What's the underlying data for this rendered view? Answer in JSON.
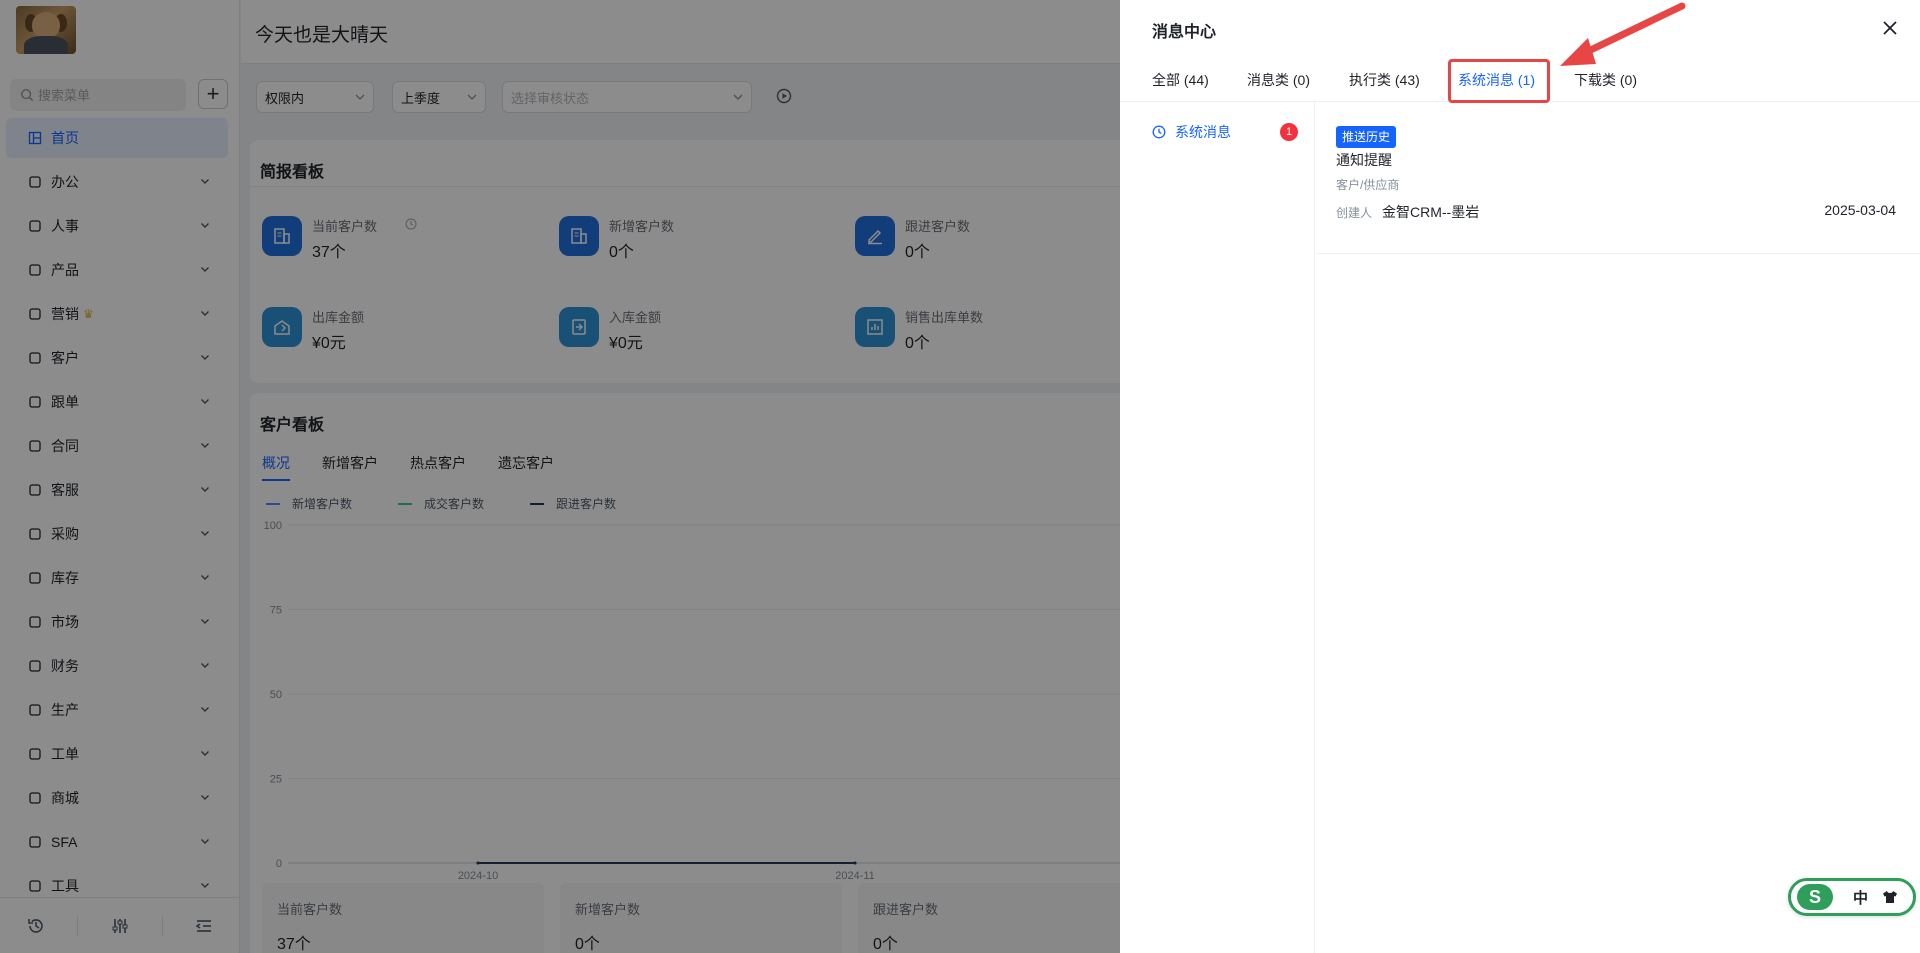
{
  "colors": {
    "primary": "#1664ff",
    "badge": "#f5313e",
    "highlight": "#e84545",
    "series_new": "#4f8ff7",
    "series_deal": "#36c3a0",
    "series_follow": "#2b3a55"
  },
  "sidebar": {
    "search_placeholder": "搜索菜单",
    "add_label": "+",
    "items": [
      {
        "label": "首页",
        "icon": "grid-icon",
        "active": true
      },
      {
        "label": "办公",
        "icon": "monitor-icon"
      },
      {
        "label": "人事",
        "icon": "people-icon"
      },
      {
        "label": "产品",
        "icon": "cube-icon"
      },
      {
        "label": "营销",
        "icon": "copy-icon",
        "crown": "♛"
      },
      {
        "label": "客户",
        "icon": "chart-icon"
      },
      {
        "label": "跟单",
        "icon": "shield-icon"
      },
      {
        "label": "合同",
        "icon": "document-icon"
      },
      {
        "label": "客服",
        "icon": "headset-icon"
      },
      {
        "label": "采购",
        "icon": "briefcase-icon"
      },
      {
        "label": "库存",
        "icon": "warehouse-icon"
      },
      {
        "label": "市场",
        "icon": "bookmark-icon"
      },
      {
        "label": "财务",
        "icon": "home-icon"
      },
      {
        "label": "生产",
        "icon": "factory-icon"
      },
      {
        "label": "工单",
        "icon": "form-icon"
      },
      {
        "label": "商城",
        "icon": "store-icon"
      },
      {
        "label": "SFA",
        "icon": "cycle-icon"
      },
      {
        "label": "工具",
        "icon": "toolbox-icon"
      }
    ],
    "footer_icons": [
      "history-icon",
      "sliders-icon",
      "collapse-icon"
    ]
  },
  "header": {
    "greeting": "今天也是大晴天"
  },
  "filters": {
    "scope": "权限内",
    "period": "上季度",
    "status_placeholder": "选择审核状态"
  },
  "brief_board": {
    "title": "简报看板",
    "kpis": [
      {
        "label": "当前客户数",
        "value": "37个"
      },
      {
        "label": "新增客户数",
        "value": "0个"
      },
      {
        "label": "跟进客户数",
        "value": "0个"
      },
      {
        "label": "出库金额",
        "value": "¥0元"
      },
      {
        "label": "入库金额",
        "value": "¥0元"
      },
      {
        "label": "销售出库单数",
        "value": "0个"
      }
    ]
  },
  "customer_board": {
    "title": "客户看板",
    "tabs": [
      "概况",
      "新增客户",
      "热点客户",
      "遗忘客户"
    ],
    "mini_kpis": [
      {
        "label": "当前客户数",
        "value": "37个"
      },
      {
        "label": "新增客户数",
        "value": "0个"
      },
      {
        "label": "跟进客户数",
        "value": "0个"
      }
    ]
  },
  "chart_data": {
    "type": "line",
    "title": "",
    "x": [
      "2024-10",
      "2024-11"
    ],
    "ylim": [
      0,
      100
    ],
    "yticks": [
      "100",
      "75",
      "50",
      "25",
      "0"
    ],
    "grid": true,
    "legend_position": "top-left",
    "series": [
      {
        "name": "新增客户数",
        "values": [
          0,
          0
        ]
      },
      {
        "name": "成交客户数",
        "values": [
          0,
          0
        ]
      },
      {
        "name": "跟进客户数",
        "values": [
          0,
          0
        ]
      }
    ]
  },
  "drawer": {
    "title": "消息中心",
    "tabs": [
      "全部 (44)",
      "消息类 (0)",
      "执行类 (43)",
      "系统消息 (1)",
      "下载类 (0)"
    ],
    "active_tab_index": 3,
    "category": {
      "label": "系统消息",
      "count": "1"
    },
    "message": {
      "tag": "推送历史",
      "title": "通知提醒",
      "category": "客户/供应商",
      "creator_label": "创建人",
      "creator": "金智CRM--墨岩",
      "date": "2025-03-04"
    }
  },
  "ime": {
    "logo": "S",
    "lang": "中"
  }
}
